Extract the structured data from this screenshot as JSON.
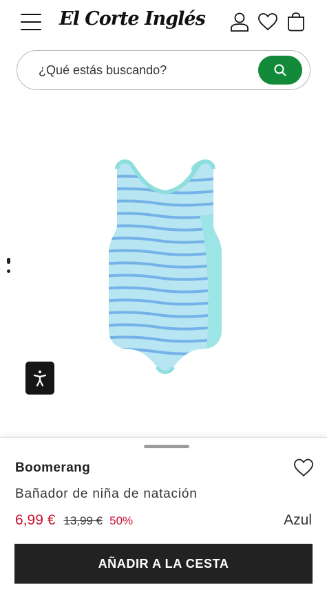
{
  "header": {
    "logo_text": "El Corte Inglés",
    "icons": [
      "menu-icon",
      "user-icon",
      "heart-icon",
      "bag-icon"
    ]
  },
  "search": {
    "placeholder": "¿Qué estás buscando?",
    "icon": "search-icon",
    "button_color": "#128a3a"
  },
  "product": {
    "brand": "Boomerang",
    "title": "Bañador de niña de natación",
    "price": "6,99 €",
    "old_price": "13,99 €",
    "discount": "50%",
    "color": "Azul",
    "add_to_cart_label": "AÑADIR A LA CESTA",
    "image": "light-blue-striped-girls-swimsuit"
  },
  "colors": {
    "price_red": "#c8102e",
    "button_dark": "#222222"
  }
}
